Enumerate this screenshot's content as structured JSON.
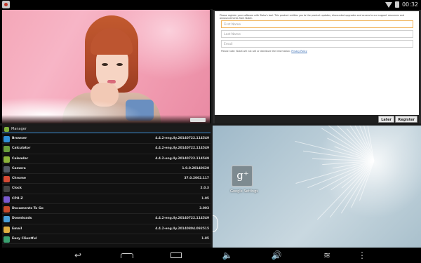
{
  "statusbar": {
    "time": "00:32"
  },
  "form": {
    "intro": "Please register your software with Slabs's tool. This product entitles you to the product updates, discounted upgrades and access to our support resources and announcements from SlabX.",
    "fields": [
      {
        "placeholder": "First Name",
        "active": true
      },
      {
        "placeholder": "Last Name",
        "active": false
      },
      {
        "placeholder": "Email",
        "active": false
      }
    ],
    "note": "Please note: SlabX will not sell or distribute the information.",
    "note_link": "Privacy Policy",
    "later_label": "Later",
    "register_label": "Register"
  },
  "manager": {
    "title": "Manager",
    "apps": [
      {
        "name": "Browser",
        "version": "4.4.2-eng.lly.20140722.114549",
        "color": "#2f8fd8"
      },
      {
        "name": "Calculator",
        "version": "4.4.2-eng.lly.20140722.114549",
        "color": "#6a9e3c"
      },
      {
        "name": "Calendar",
        "version": "4.4.2-eng.lly.20140722.114549",
        "color": "#8cb43a"
      },
      {
        "name": "Camera",
        "version": "1.0.0.20140620",
        "color": "#555b66"
      },
      {
        "name": "Chrome",
        "version": "37.0.2062.117",
        "color": "#d64a34"
      },
      {
        "name": "Clock",
        "version": "2.0.3",
        "color": "#444444"
      },
      {
        "name": "CPU-Z",
        "version": "1.05",
        "color": "#7a5ad0"
      },
      {
        "name": "Documents To Go",
        "version": "3.003",
        "color": "#c94a2a"
      },
      {
        "name": "Downloads",
        "version": "4.4.2-eng.lly.20140722.114549",
        "color": "#4aa0d8"
      },
      {
        "name": "Email",
        "version": "4.4.2-eng.lly.20140804.092515",
        "color": "#e0b040"
      },
      {
        "name": "Easy Clientful",
        "version": "1.85",
        "color": "#3aa070"
      }
    ]
  },
  "home": {
    "shortcut_label": "Google Settings",
    "shortcut_glyph": "g⁺"
  },
  "navbar": {
    "back_glyph": "↩",
    "voldown_glyph": "🔈",
    "volup_glyph": "🔊",
    "fold_glyph": "≋",
    "menu_glyph": "⋮"
  }
}
